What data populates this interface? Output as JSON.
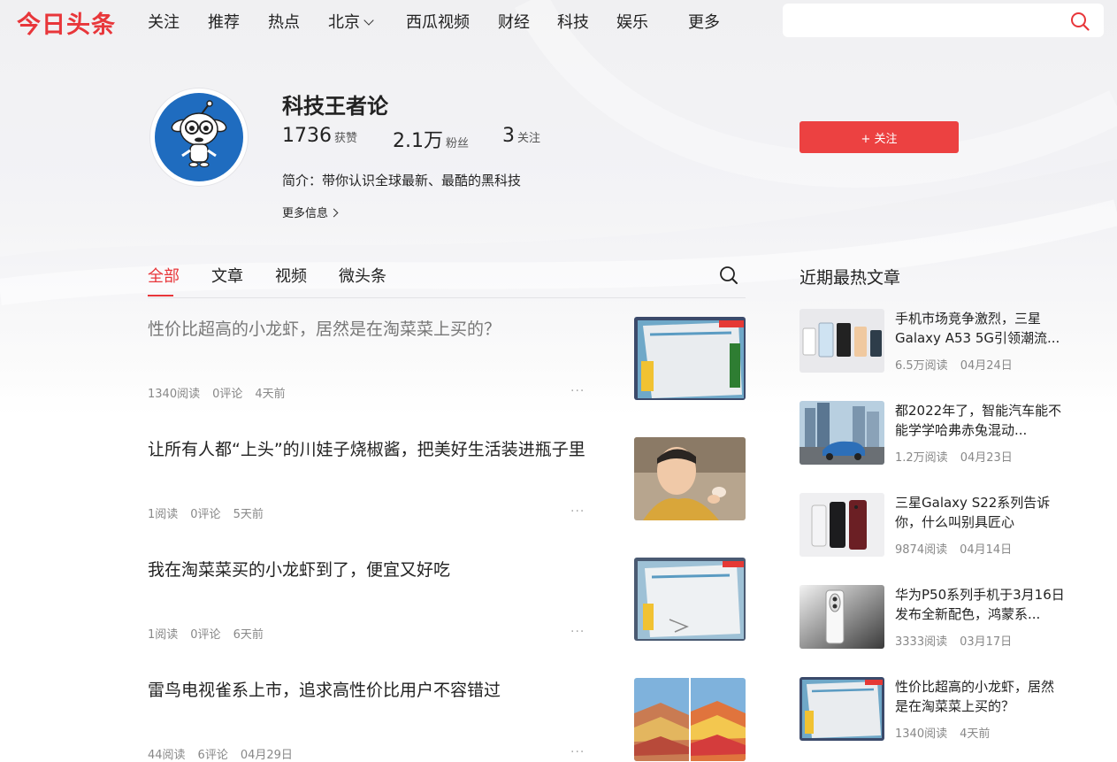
{
  "header": {
    "logo": "今日头条",
    "nav": [
      "关注",
      "推荐",
      "热点",
      "北京",
      "西瓜视频",
      "财经",
      "科技",
      "娱乐",
      "更多"
    ],
    "search_placeholder": ""
  },
  "profile": {
    "name": "科技王者论",
    "likes_value": "1736",
    "likes_label": "获赞",
    "fans_value": "2.1万",
    "fans_label": "粉丝",
    "following_value": "3",
    "following_label": "关注",
    "intro": "简介：带你认识全球最新、最酷的黑科技",
    "more_info": "更多信息",
    "follow_button": "+ 关注"
  },
  "tabs": [
    "全部",
    "文章",
    "视频",
    "微头条"
  ],
  "feed": [
    {
      "title": "性价比超高的小龙虾，居然是在淘菜菜上买的？",
      "reads": "1340阅读",
      "comments": "0评论",
      "time": "4天前",
      "thumb": "shrimp-package"
    },
    {
      "title": "让所有人都“上头”的川娃子烧椒酱，把美好生活装进瓶子里",
      "reads": "1阅读",
      "comments": "0评论",
      "time": "5天前",
      "thumb": "man-eating"
    },
    {
      "title": "我在淘菜菜买的小龙虾到了，便宜又好吃",
      "reads": "1阅读",
      "comments": "0评论",
      "time": "6天前",
      "thumb": "shrimp-package"
    },
    {
      "title": "雷鸟电视雀系上市，追求高性价比用户不容错过",
      "reads": "44阅读",
      "comments": "6评论",
      "time": "04月29日",
      "thumb": "rainbow-mountains"
    }
  ],
  "sidebar": {
    "title": "近期最热文章",
    "items": [
      {
        "title": "手机市场竞争激烈，三星Galaxy A53 5G引领潮流...",
        "reads": "6.5万阅读",
        "date": "04月24日",
        "thumb": "phones-lineup"
      },
      {
        "title": "都2022年了，智能汽车能不能学学哈弗赤兔混动...",
        "reads": "1.2万阅读",
        "date": "04月23日",
        "thumb": "suv-city"
      },
      {
        "title": "三星Galaxy S22系列告诉你，什么叫别具匠心",
        "reads": "9874阅读",
        "date": "04月14日",
        "thumb": "galaxy-s22"
      },
      {
        "title": "华为P50系列手机于3月16日发布全新配色，鸿蒙系...",
        "reads": "3333阅读",
        "date": "03月17日",
        "thumb": "huawei-p50"
      },
      {
        "title": "性价比超高的小龙虾，居然是在淘菜菜上买的？",
        "reads": "1340阅读",
        "date": "4天前",
        "thumb": "shrimp-package"
      }
    ]
  },
  "colors": {
    "accent": "#e8363a",
    "button": "#ec4141"
  }
}
